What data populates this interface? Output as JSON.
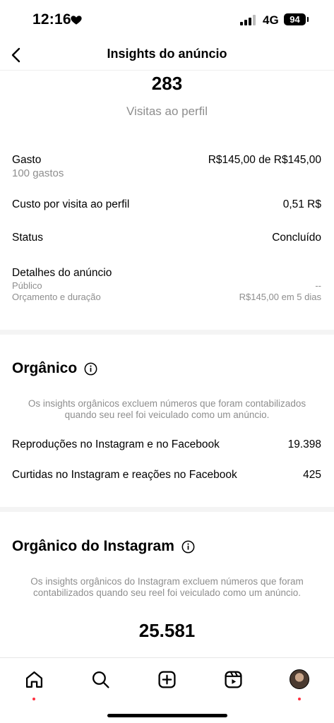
{
  "status_bar": {
    "time": "12:16",
    "network": "4G",
    "battery": "94"
  },
  "header": {
    "title": "Insights do anúncio",
    "back_icon": "chevron-left-icon"
  },
  "summary": {
    "value": "283",
    "caption": "Visitas ao perfil"
  },
  "ad_details": {
    "spend_label": "Gasto",
    "spend_value": "R$145,00 de R$145,00",
    "spend_sub": "100 gastos",
    "cost_label": "Custo por visita ao perfil",
    "cost_value": "0,51 R$",
    "status_label": "Status",
    "status_value": "Concluído",
    "details_label": "Detalhes do anúncio",
    "audience_label": "Público",
    "audience_value": "--",
    "budget_label": "Orçamento e duração",
    "budget_value": "R$145,00 em 5 dias"
  },
  "organic": {
    "title": "Orgânico",
    "note": "Os insights orgânicos excluem números que foram contabilizados quando seu reel foi veiculado como um anúncio.",
    "plays_label": "Reproduções no Instagram e no Facebook",
    "plays_value": "19.398",
    "likes_label": "Curtidas no Instagram e reações no Facebook",
    "likes_value": "425"
  },
  "organic_instagram": {
    "title": "Orgânico do Instagram",
    "note": "Os insights orgânicos do Instagram excluem números que foram contabilizados quando seu reel foi veiculado como um anúncio.",
    "value": "25.581"
  },
  "tabbar": {
    "items": [
      "home-icon",
      "search-icon",
      "create-icon",
      "reels-icon",
      "profile-avatar"
    ],
    "notification_color": "#ff3040"
  }
}
